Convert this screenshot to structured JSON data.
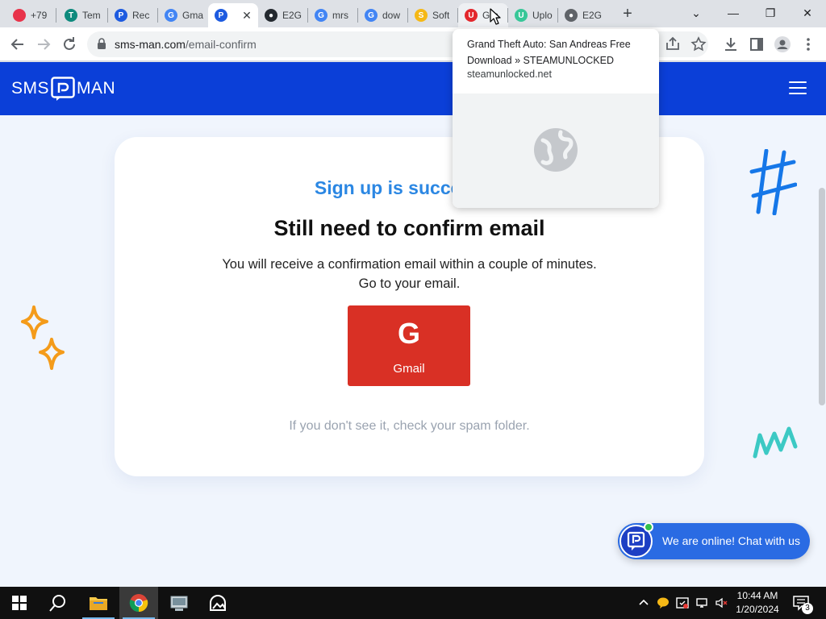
{
  "browser": {
    "tabs": [
      {
        "title": "+79",
        "favicon": "opera-icon",
        "color": "#e8334a",
        "glyph": ""
      },
      {
        "title": "Tem",
        "favicon": "temp-mail-icon",
        "color": "#0e8a7d",
        "glyph": "T"
      },
      {
        "title": "Rec",
        "favicon": "sms-man-icon",
        "color": "#1d5be0",
        "glyph": "P"
      },
      {
        "title": "Gma",
        "favicon": "google-icon",
        "color": "#4285f4",
        "glyph": "G"
      },
      {
        "title": "",
        "favicon": "sms-man-icon",
        "color": "#1d5be0",
        "glyph": "P"
      },
      {
        "title": "E2G",
        "favicon": "github-icon",
        "color": "#24292f",
        "glyph": "●"
      },
      {
        "title": "mrs",
        "favicon": "google-icon",
        "color": "#4285f4",
        "glyph": "G"
      },
      {
        "title": "dow",
        "favicon": "google-icon",
        "color": "#4285f4",
        "glyph": "G"
      },
      {
        "title": "Soft",
        "favicon": "softonic-icon",
        "color": "#f5b816",
        "glyph": "S"
      },
      {
        "title": "Gra",
        "favicon": "steamunlocked-icon",
        "color": "#e3272c",
        "glyph": "U"
      },
      {
        "title": "Uplo",
        "favicon": "upload-icon",
        "color": "#38c798",
        "glyph": "U"
      },
      {
        "title": "E2G",
        "favicon": "globe-icon",
        "color": "#5f6368",
        "glyph": "●"
      }
    ],
    "new_tab_label": "+",
    "window_controls": {
      "tab_search": "⌄",
      "minimize": "—",
      "restore": "❐",
      "close": "✕"
    },
    "address": {
      "host": "sms-man.com",
      "path": "/email-confirm"
    },
    "hover_card": {
      "title": "Grand Theft Auto: San Andreas Free Download » STEAMUNLOCKED",
      "domain": "steamunlocked.net"
    }
  },
  "page": {
    "brand_left": "SMS",
    "brand_right": "MAN",
    "kicker": "Sign up is successful",
    "title": "Still need to confirm email",
    "body": "You will receive a confirmation email within a couple of minutes. Go to your email.",
    "gmail_button": {
      "glyph": "G",
      "label": "Gmail"
    },
    "note": "If you don't see it, check your spam folder.",
    "chat": "We are online! Chat with us",
    "colors": {
      "header": "#0b3fd8",
      "accent": "#2b87e3",
      "gmail": "#d93025"
    }
  },
  "taskbar": {
    "time": "10:44 AM",
    "date": "1/20/2024",
    "notifications": "3"
  }
}
